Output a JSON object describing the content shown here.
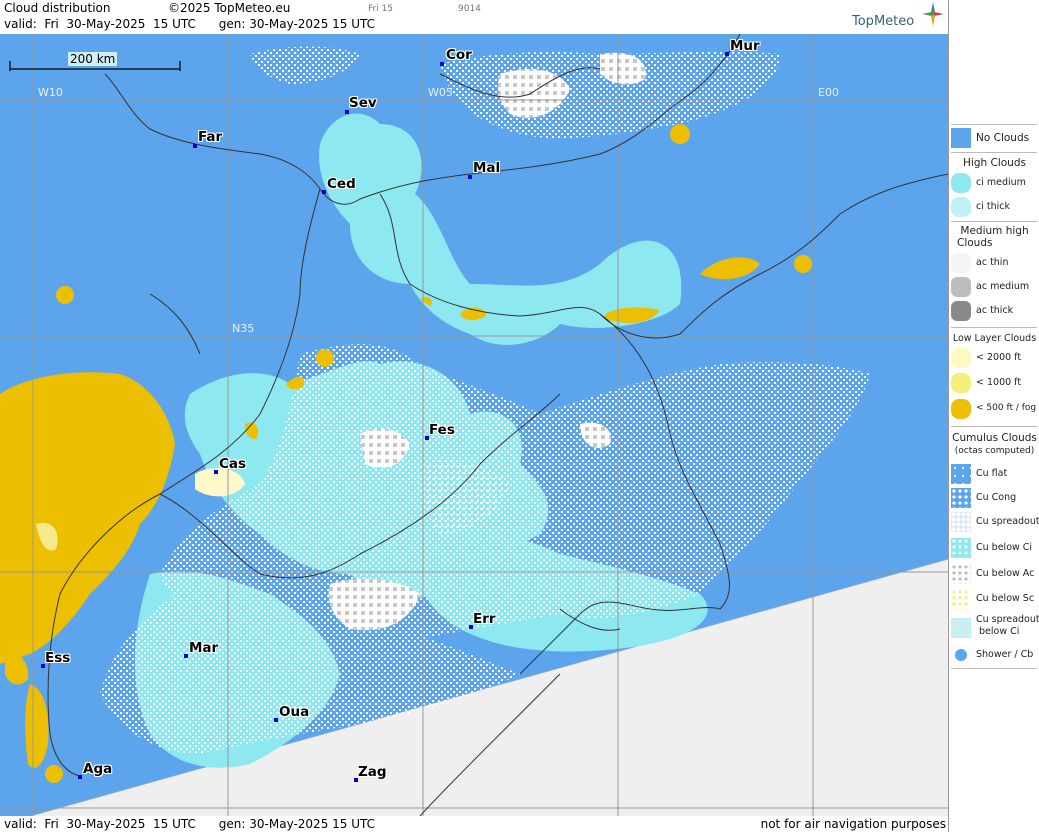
{
  "header": {
    "title": "Cloud distribution",
    "copyright": "©2025 TopMeteo.eu",
    "valid_line": "valid:  Fri  30-May-2025  15 UTC      gen: 30-May-2025 15 UTC",
    "small_label_1": "Fri 15",
    "small_label_2": "9014",
    "logo": "TopMeteo"
  },
  "footer": {
    "valid_line": "valid:  Fri  30-May-2025  15 UTC      gen: 30-May-2025 15 UTC",
    "disclaimer": "not for air navigation purposes"
  },
  "map": {
    "scale_label": "200 km",
    "grid_labels": {
      "w10": "W10",
      "w05": "W05",
      "e00": "E00",
      "n35": "N35"
    },
    "cities": [
      {
        "name": "Cor"
      },
      {
        "name": "Mur"
      },
      {
        "name": "Sev"
      },
      {
        "name": "Far"
      },
      {
        "name": "Mal"
      },
      {
        "name": "Ced"
      },
      {
        "name": "Fes"
      },
      {
        "name": "Cas"
      },
      {
        "name": "Err"
      },
      {
        "name": "Mar"
      },
      {
        "name": "Ess"
      },
      {
        "name": "Oua"
      },
      {
        "name": "Aga"
      },
      {
        "name": "Zag"
      }
    ],
    "colors": {
      "no_clouds": "#5ca4ec",
      "ci": "#8ee8f0",
      "low": "#ecc000",
      "cumulus": "#ffffff",
      "ac": "#c8c8c8",
      "outside": "#efefef"
    }
  },
  "legend": {
    "no_clouds": "No Clouds",
    "high_head": "High Clouds",
    "ci_medium": "ci medium",
    "ci_thick": "ci thick",
    "medium_head_1": "Medium high",
    "medium_head_2": "Clouds",
    "ac_thin": "ac thin",
    "ac_medium": "ac medium",
    "ac_thick": "ac thick",
    "low_head": "Low Layer Clouds",
    "low_2000": "< 2000 ft",
    "low_1000": "< 1000 ft",
    "low_500": "< 500 ft / fog",
    "cu_head_1": "Cumulus Clouds",
    "cu_head_2": "(octas computed)",
    "cu_flat": "Cu flat",
    "cu_cong": "Cu Cong",
    "cu_spreadout": "Cu spreadout",
    "cu_below_ci": "Cu below Ci",
    "cu_below_ac": "Cu below Ac",
    "cu_below_sc": "Cu below Sc",
    "cu_spread_below_ci_1": "Cu spreadout",
    "cu_spread_below_ci_2": "below Ci",
    "shower_cb": "Shower / Cb"
  }
}
